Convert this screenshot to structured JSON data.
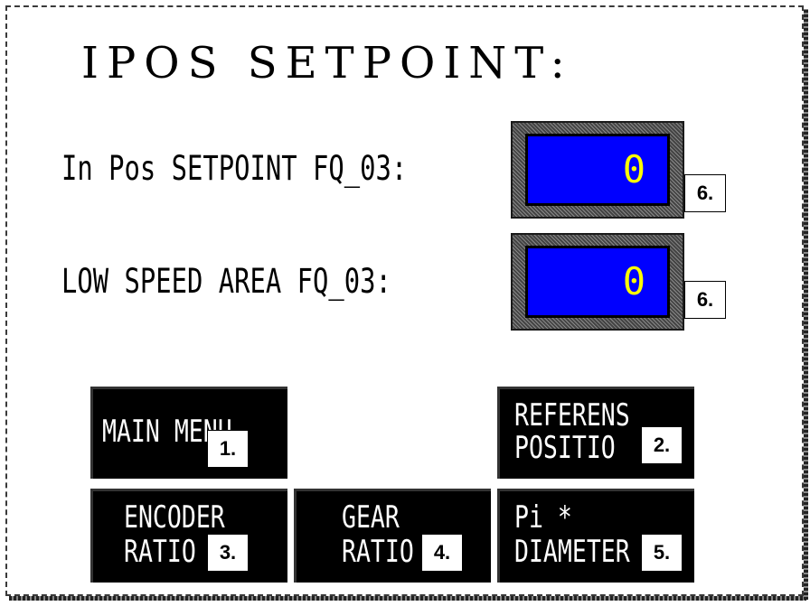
{
  "screen": {
    "title": "IPOS SETPOINT:"
  },
  "fields": [
    {
      "label": "In Pos SETPOINT FQ_03:",
      "value": "0",
      "tag": "6."
    },
    {
      "label": "LOW SPEED AREA FQ_03:",
      "value": "0",
      "tag": "6."
    }
  ],
  "buttons": {
    "main_menu": {
      "line1": "MAIN MENU",
      "tag": "1."
    },
    "referens": {
      "line1": "REFERENS",
      "line2": "POSITIO",
      "tag": "2."
    },
    "encoder": {
      "line1": "ENCODER",
      "line2": "RATIO",
      "tag": "3."
    },
    "gear": {
      "line1": "GEAR",
      "line2": "RATIO",
      "tag": "4."
    },
    "pi": {
      "line1": "Pi *",
      "line2": "DIAMETER",
      "tag": "5."
    }
  },
  "colors": {
    "field_bg": "#0000ff",
    "value_text": "#ffff00",
    "button_bg": "#000000"
  }
}
